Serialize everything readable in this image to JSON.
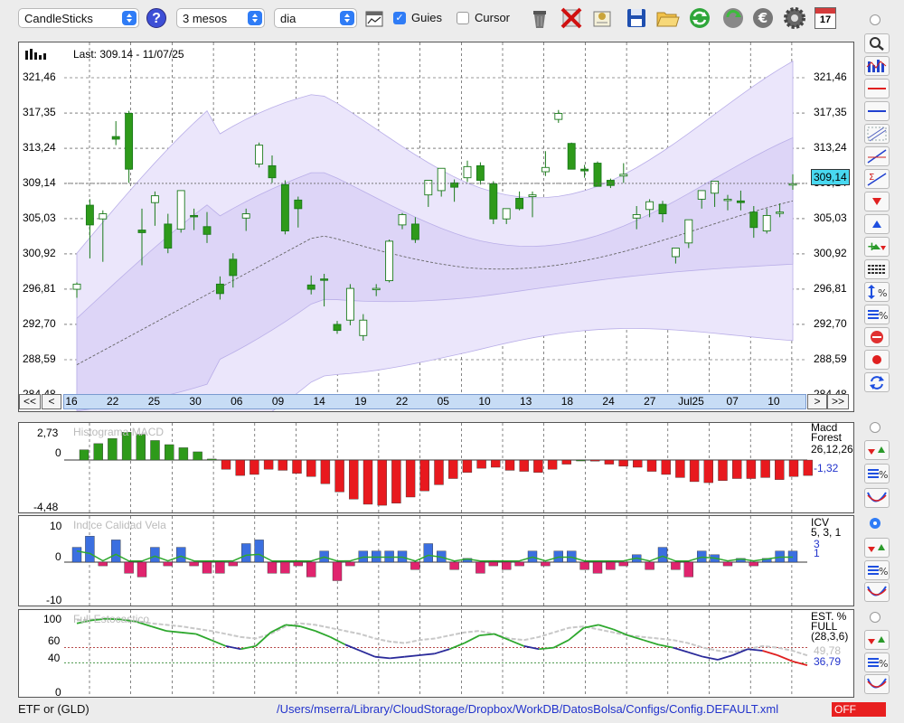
{
  "toolbar": {
    "chart_type": "CandleSticks",
    "period": "3 mesos",
    "interval": "dia",
    "guides_label": "Guies",
    "guides_checked": true,
    "cursor_label": "Cursor",
    "cursor_checked": false,
    "calendar_day": "17",
    "icons": [
      "help-icon",
      "chart-icon",
      "trash-icon",
      "delete-icon",
      "certificate-icon",
      "save-icon",
      "folder-icon",
      "refresh-icon",
      "update-icon",
      "euro-icon",
      "gear-icon",
      "calendar-icon"
    ]
  },
  "price_chart": {
    "last_label": "Last: 309.14 - 11/07/25",
    "y_ticks": [
      "321,46",
      "317,35",
      "313,24",
      "309,14",
      "305,03",
      "300,92",
      "296,81",
      "292,70",
      "288,59",
      "284,48"
    ],
    "current_price": "309,14",
    "x_ticks": [
      "16",
      "22",
      "25",
      "30",
      "06",
      "09",
      "14",
      "19",
      "22",
      "05",
      "10",
      "13",
      "18",
      "24",
      "27",
      "Jul25",
      "07",
      "10"
    ],
    "nav": {
      "first": "<<",
      "prev": "<",
      "next": ">",
      "last": ">>"
    },
    "colors": {
      "up": "#ffffff",
      "down": "#2e9a1a",
      "band": "#e9e3fb",
      "band_inner": "#d9d0f6"
    }
  },
  "macd_panel": {
    "title": "Histograma MACD",
    "y_ticks": [
      "2,73",
      "0",
      "-4,48"
    ],
    "name": "Macd Forest",
    "params": "26,12,26",
    "value": "-1,32"
  },
  "icv_panel": {
    "title": "Indice Calidad Vela",
    "y_ticks": [
      "10",
      "0",
      "-10"
    ],
    "name": "ICV",
    "params": "5, 3, 1",
    "value1": "3",
    "value2": "1"
  },
  "stoch_panel": {
    "title": "Full Estocastico",
    "y_ticks": [
      "100",
      "60",
      "40",
      "0"
    ],
    "name": "EST. %",
    "name2": "FULL",
    "params": "(28,3,6)",
    "value1": "49,78",
    "value2": "36,79"
  },
  "chart_data": [
    {
      "type": "candlestick",
      "ylim": [
        284.48,
        325.57
      ],
      "dates": [
        "16",
        "17",
        "18",
        "20",
        "22",
        "23",
        "24",
        "25",
        "26",
        "27",
        "30",
        "02",
        "03",
        "06",
        "07",
        "08",
        "09",
        "10",
        "13",
        "14",
        "15",
        "16",
        "19",
        "20",
        "21",
        "22",
        "23",
        "26",
        "27",
        "28",
        "29",
        "05",
        "06",
        "07",
        "09",
        "10",
        "11",
        "12",
        "13",
        "16",
        "17",
        "18",
        "19",
        "20",
        "23",
        "24",
        "25",
        "26",
        "27",
        "30",
        "Jul25",
        "03",
        "07",
        "08",
        "09",
        "10",
        "11"
      ],
      "last": 309.14
    },
    {
      "type": "bar",
      "title": "Histograma MACD",
      "ylim": [
        -4.48,
        2.73
      ],
      "values": [
        1.0,
        1.6,
        2.1,
        2.7,
        2.5,
        1.9,
        1.5,
        1.2,
        0.8,
        0.1,
        -0.9,
        -1.5,
        -1.4,
        -0.9,
        -1.0,
        -1.3,
        -1.6,
        -2.3,
        -3.1,
        -3.8,
        -4.3,
        -4.4,
        -4.2,
        -3.6,
        -3.0,
        -2.4,
        -1.8,
        -1.2,
        -0.8,
        -0.7,
        -1.0,
        -1.1,
        -1.2,
        -0.9,
        -0.4,
        0.0,
        -0.1,
        -0.4,
        -0.6,
        -0.7,
        -1.1,
        -1.4,
        -1.7,
        -2.1,
        -2.2,
        -2.0,
        -1.8,
        -1.8,
        -1.7,
        -1.9,
        -1.6,
        -1.5
      ]
    },
    {
      "type": "bar",
      "title": "Indice Calidad Vela",
      "ylim": [
        -10,
        10
      ],
      "values": [
        4,
        7,
        -1,
        6,
        -3,
        -4,
        4,
        -1,
        4,
        -1,
        -3,
        -3,
        -1,
        5,
        6,
        -3,
        -3,
        -1,
        -4,
        3,
        -5,
        -1,
        3,
        3,
        3,
        3,
        -2,
        5,
        3,
        -2,
        1,
        -3,
        -1,
        -2,
        -1,
        3,
        -1,
        3,
        3,
        -2,
        -3,
        -2,
        -1,
        2,
        -2,
        4,
        -2,
        -4,
        3,
        2,
        -1,
        1,
        -1,
        1,
        3,
        3
      ]
    },
    {
      "type": "line",
      "title": "Full Estocastico",
      "ylim": [
        0,
        100
      ],
      "series": [
        {
          "values": [
            96,
            97,
            98,
            97,
            95,
            92,
            90,
            88,
            85,
            82,
            78,
            74,
            72,
            78,
            88,
            92,
            90,
            86,
            82,
            78,
            72,
            68,
            66,
            70,
            72,
            76,
            80,
            82,
            78,
            72,
            70,
            74,
            80,
            86,
            88,
            84,
            80,
            76,
            74,
            72,
            70,
            66,
            60,
            56,
            54,
            58,
            62,
            60,
            56,
            49.78
          ]
        },
        {
          "values": [
            92,
            96,
            98,
            97,
            94,
            88,
            82,
            80,
            78,
            70,
            62,
            58,
            62,
            80,
            90,
            88,
            82,
            74,
            64,
            56,
            48,
            46,
            48,
            50,
            52,
            58,
            66,
            76,
            78,
            70,
            62,
            58,
            60,
            70,
            86,
            90,
            84,
            76,
            70,
            64,
            60,
            54,
            48,
            44,
            50,
            58,
            56,
            50,
            42,
            36.79
          ]
        }
      ]
    }
  ]
}
